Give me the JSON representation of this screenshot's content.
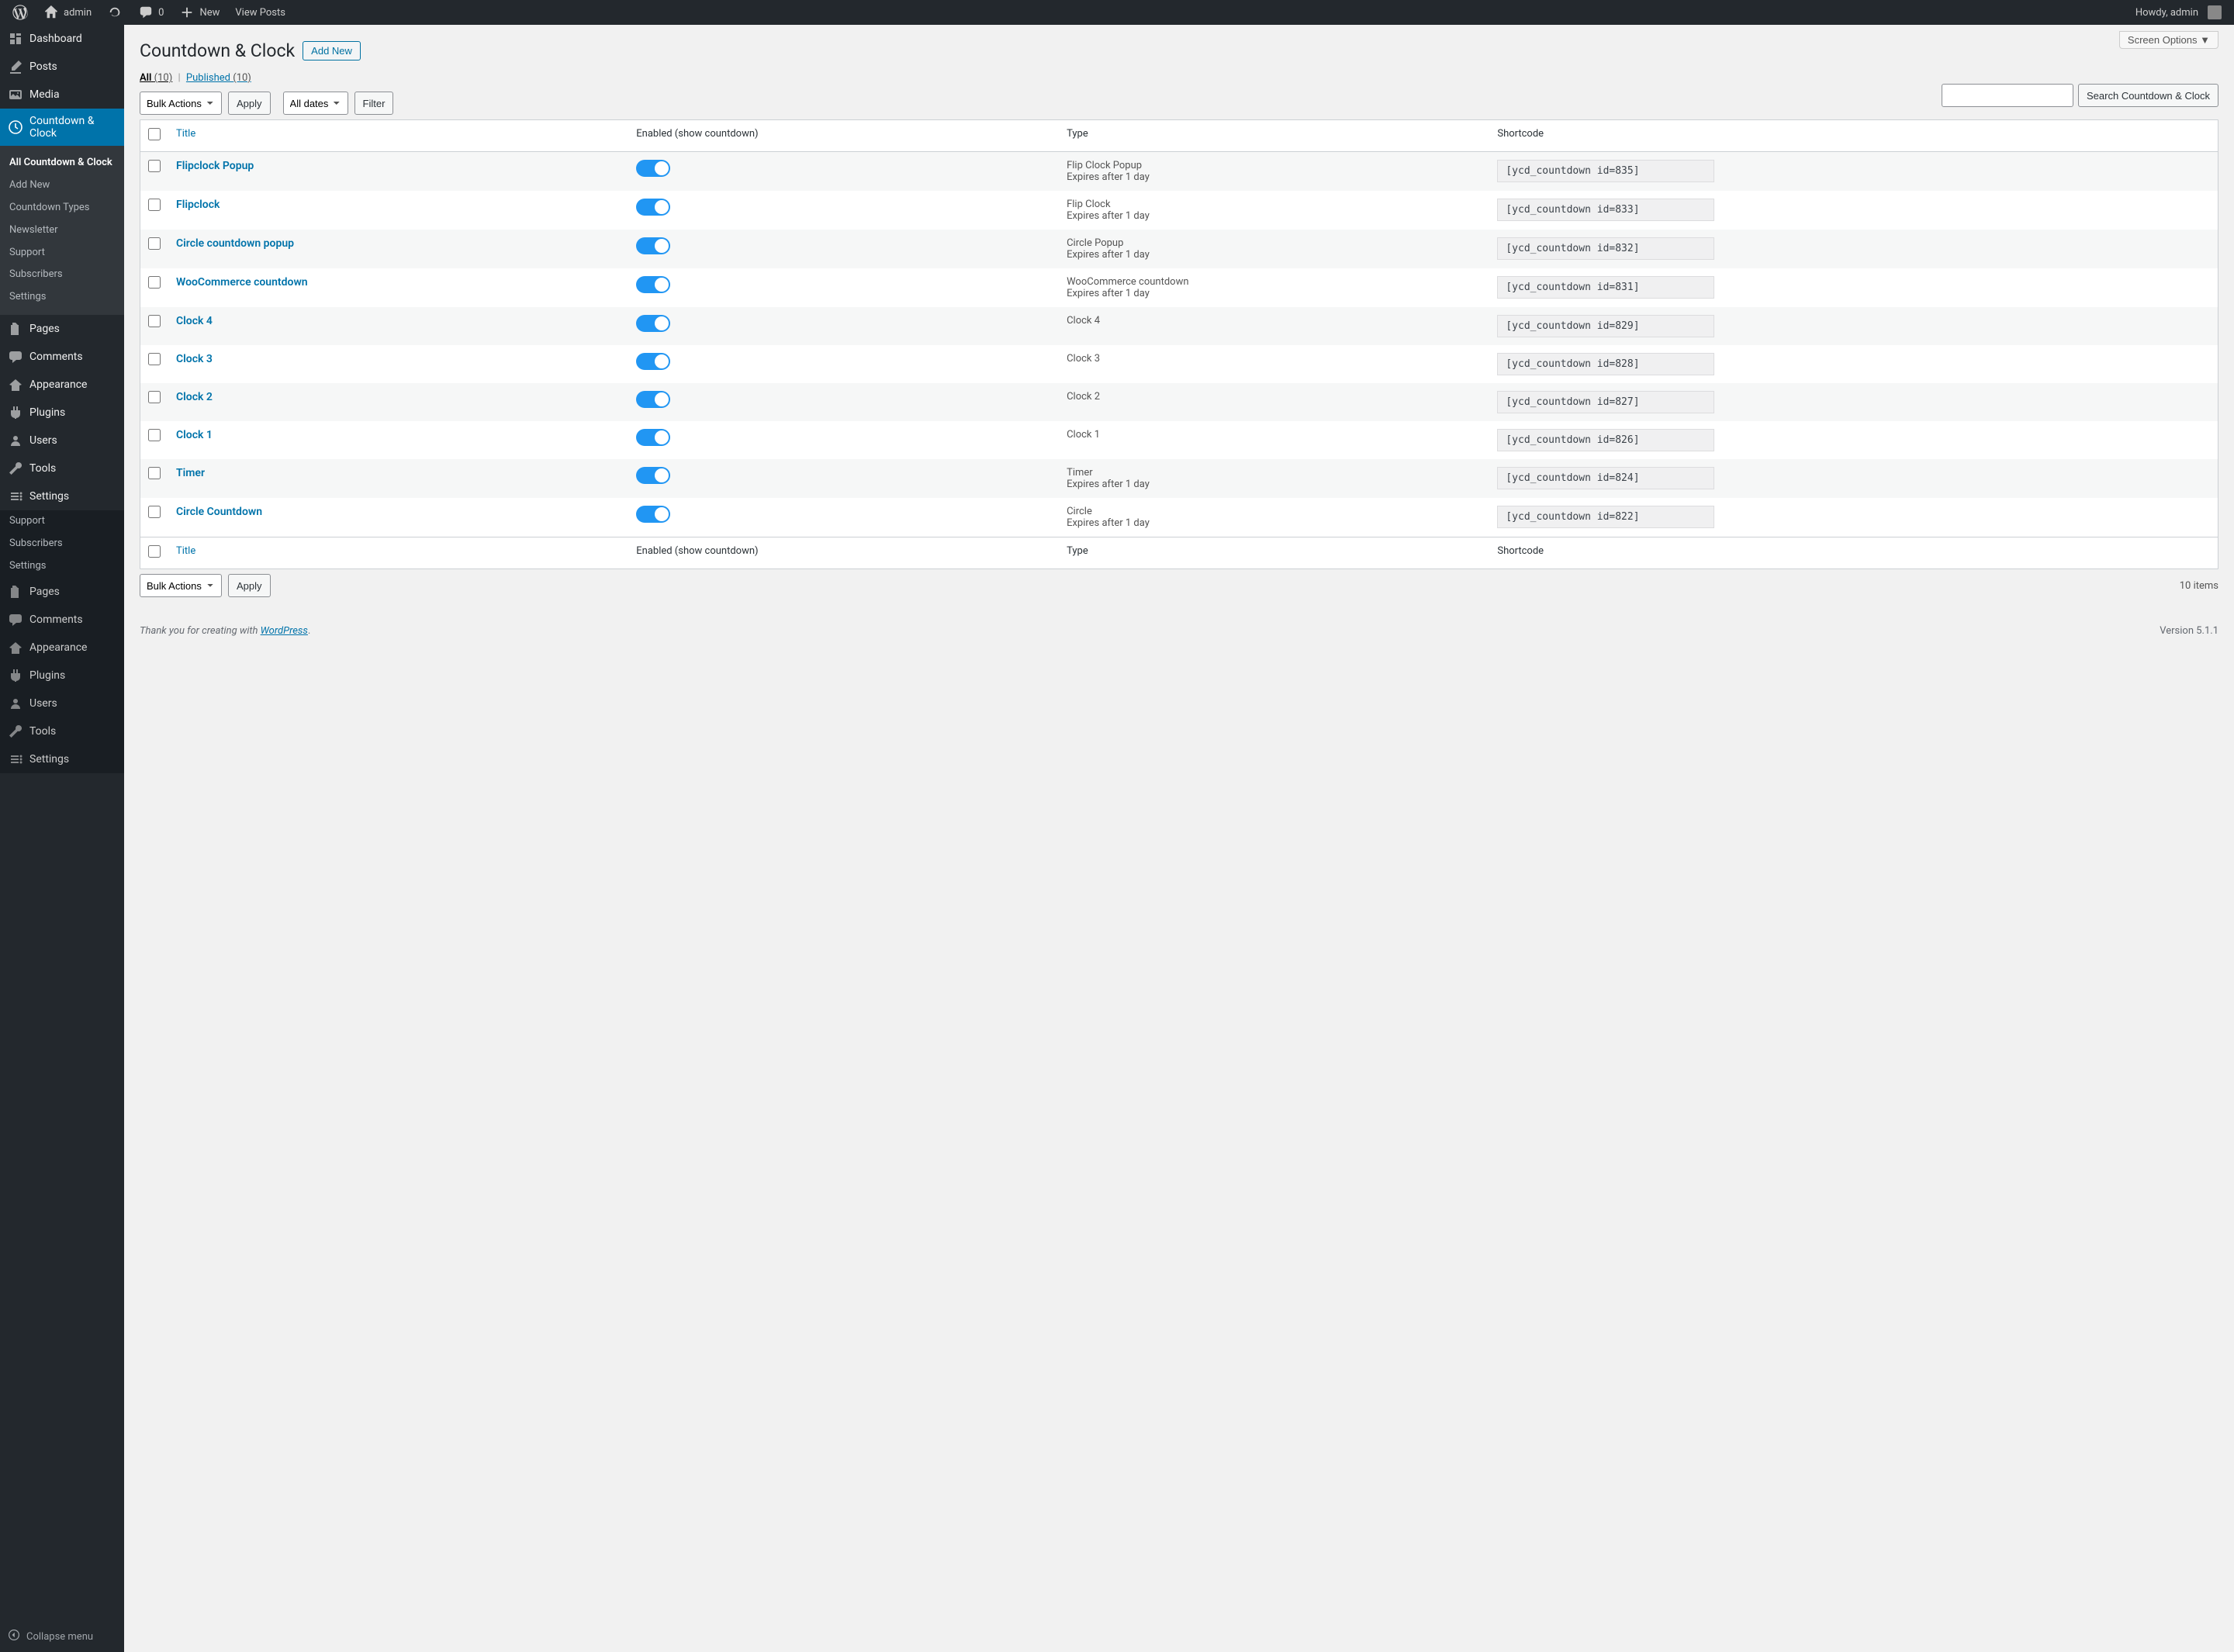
{
  "adminbar": {
    "site_name": "admin",
    "comments_count": "0",
    "new_label": "New",
    "view_posts": "View Posts",
    "howdy": "Howdy, admin"
  },
  "sidebar": {
    "items": [
      {
        "icon": "dashboard",
        "label": "Dashboard"
      },
      {
        "icon": "posts",
        "label": "Posts"
      },
      {
        "icon": "media",
        "label": "Media"
      },
      {
        "icon": "clock",
        "label": "Countdown & Clock",
        "current": true
      },
      {
        "icon": "pages",
        "label": "Pages"
      },
      {
        "icon": "comments",
        "label": "Comments"
      },
      {
        "icon": "appearance",
        "label": "Appearance"
      },
      {
        "icon": "plugins",
        "label": "Plugins"
      },
      {
        "icon": "users",
        "label": "Users"
      },
      {
        "icon": "tools",
        "label": "Tools"
      },
      {
        "icon": "settings",
        "label": "Settings"
      }
    ],
    "submenu": [
      {
        "label": "All Countdown & Clock",
        "current": true
      },
      {
        "label": "Add New"
      },
      {
        "label": "Countdown Types"
      },
      {
        "label": "Newsletter"
      },
      {
        "label": "Support"
      },
      {
        "label": "Subscribers"
      },
      {
        "label": "Settings"
      }
    ],
    "dim_submenu": [
      {
        "label": "Support"
      },
      {
        "label": "Subscribers"
      },
      {
        "label": "Settings"
      }
    ],
    "dim_items": [
      {
        "icon": "pages",
        "label": "Pages"
      },
      {
        "icon": "comments",
        "label": "Comments"
      },
      {
        "icon": "appearance",
        "label": "Appearance"
      },
      {
        "icon": "plugins",
        "label": "Plugins"
      },
      {
        "icon": "users",
        "label": "Users"
      },
      {
        "icon": "tools",
        "label": "Tools"
      },
      {
        "icon": "settings",
        "label": "Settings"
      }
    ],
    "collapse": "Collapse menu"
  },
  "screen_options": "Screen Options ▼",
  "header": {
    "title": "Countdown & Clock",
    "add_new": "Add New"
  },
  "views": {
    "all_label": "All",
    "all_count": "(10)",
    "sep": "|",
    "published_label": "Published",
    "published_count": "(10)"
  },
  "top_nav": {
    "bulk_actions": "Bulk Actions",
    "apply": "Apply",
    "all_dates": "All dates",
    "filter": "Filter",
    "items_count": "10 items"
  },
  "search": {
    "button": "Search Countdown & Clock"
  },
  "columns": {
    "title": "Title",
    "enabled": "Enabled (show countdown)",
    "type": "Type",
    "shortcode": "Shortcode"
  },
  "rows": [
    {
      "title": "Flipclock Popup",
      "type": "Flip Clock Popup",
      "expires": "Expires after 1 day",
      "shortcode": "[ycd_countdown id=835]"
    },
    {
      "title": "Flipclock",
      "type": "Flip Clock",
      "expires": "Expires after 1 day",
      "shortcode": "[ycd_countdown id=833]"
    },
    {
      "title": "Circle countdown popup",
      "type": "Circle Popup",
      "expires": "Expires after 1 day",
      "shortcode": "[ycd_countdown id=832]"
    },
    {
      "title": "WooCommerce countdown",
      "type": "WooCommerce countdown",
      "expires": "Expires after 1 day",
      "shortcode": "[ycd_countdown id=831]"
    },
    {
      "title": "Clock 4",
      "type": "Clock 4",
      "expires": "",
      "shortcode": "[ycd_countdown id=829]"
    },
    {
      "title": "Clock 3",
      "type": "Clock 3",
      "expires": "",
      "shortcode": "[ycd_countdown id=828]"
    },
    {
      "title": "Clock 2",
      "type": "Clock 2",
      "expires": "",
      "shortcode": "[ycd_countdown id=827]"
    },
    {
      "title": "Clock 1",
      "type": "Clock 1",
      "expires": "",
      "shortcode": "[ycd_countdown id=826]"
    },
    {
      "title": "Timer",
      "type": "Timer",
      "expires": "Expires after 1 day",
      "shortcode": "[ycd_countdown id=824]"
    },
    {
      "title": "Circle Countdown",
      "type": "Circle",
      "expires": "Expires after 1 day",
      "shortcode": "[ycd_countdown id=822]"
    }
  ],
  "footer": {
    "thanks_prefix": "Thank you for creating with ",
    "wordpress": "WordPress",
    "period": ".",
    "version": "Version 5.1.1"
  }
}
